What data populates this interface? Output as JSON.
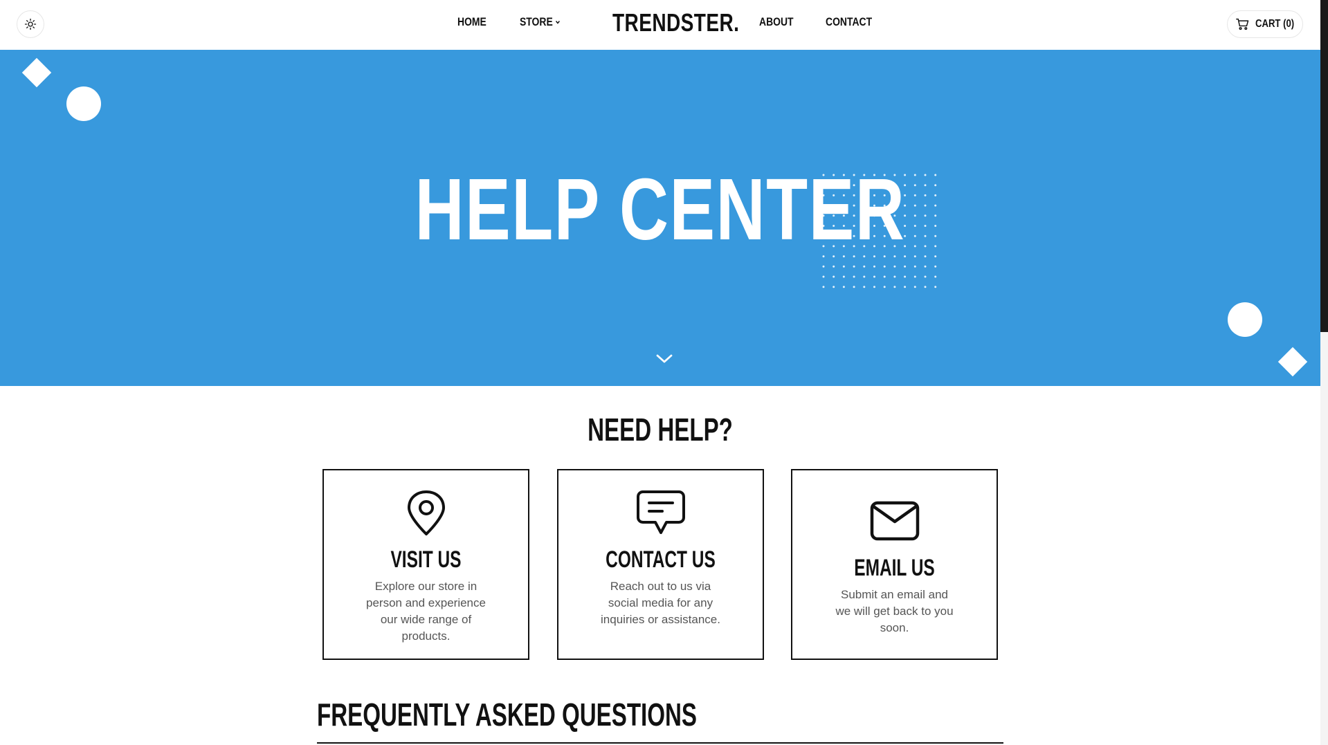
{
  "colors": {
    "hero_background": "#3899dd",
    "text": "#111111",
    "muted_text": "#555555",
    "page_background": "#ffffff"
  },
  "header": {
    "theme_toggle_icon": "sun-icon",
    "nav": {
      "home": "HOME",
      "store": "STORE",
      "about": "ABOUT",
      "contact": "CONTACT"
    },
    "brand": "TRENDSTER.",
    "cart": {
      "icon": "cart-icon",
      "label": "CART (0)"
    }
  },
  "hero": {
    "title": "HELP CENTER",
    "scroll_icon": "chevron-down-icon"
  },
  "need_help": {
    "title": "NEED HELP?",
    "cards": [
      {
        "icon": "map-pin-icon",
        "title": "VISIT US",
        "description": "Explore our store in person and experience our wide range of products."
      },
      {
        "icon": "chat-bubble-icon",
        "title": "CONTACT US",
        "description": "Reach out to us via social media for any inquiries or assistance."
      },
      {
        "icon": "envelope-icon",
        "title": "EMAIL US",
        "description": "Submit an email and we will get back to you soon."
      }
    ]
  },
  "faq": {
    "title": "FREQUENTLY ASKED QUESTIONS"
  }
}
